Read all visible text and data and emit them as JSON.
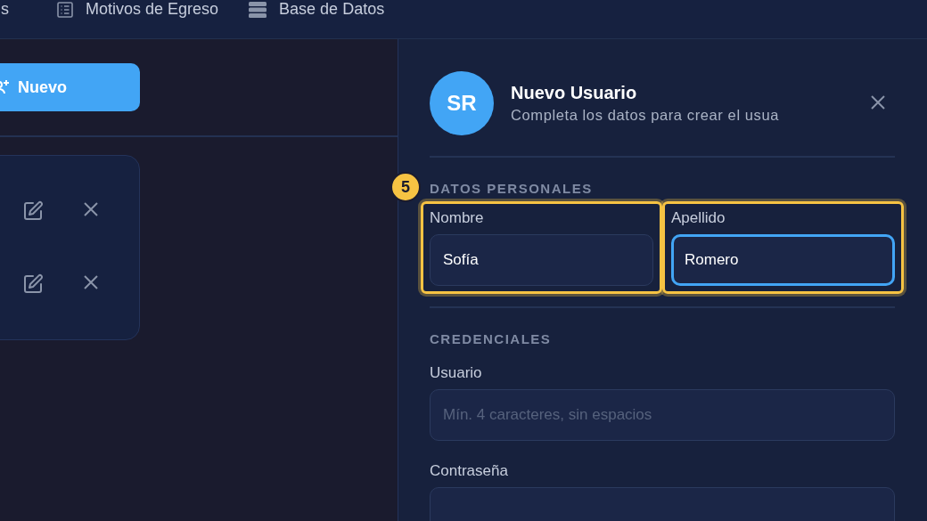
{
  "nav": {
    "items": [
      {
        "label": "s"
      },
      {
        "label": "Motivos de Egreso"
      },
      {
        "label": "Base de Datos"
      }
    ]
  },
  "list_panel": {
    "new_button": "Nuevo"
  },
  "form": {
    "avatar": "SR",
    "title": "Nuevo Usuario",
    "subtitle": "Completa los datos para crear el usua",
    "step_badge": "5",
    "sections": [
      {
        "title": "DATOS PERSONALES",
        "fields": [
          {
            "label": "Nombre",
            "value": "Sofía",
            "focused": false,
            "highlighted": true
          },
          {
            "label": "Apellido",
            "value": "Romero",
            "focused": true,
            "highlighted": true
          }
        ]
      },
      {
        "title": "CREDENCIALES",
        "fields": [
          {
            "label": "Usuario",
            "placeholder": "Mín. 4 caracteres, sin espacios",
            "focused": false,
            "highlighted": false
          },
          {
            "label": "Contraseña",
            "focused": false,
            "highlighted": false
          }
        ]
      }
    ]
  }
}
